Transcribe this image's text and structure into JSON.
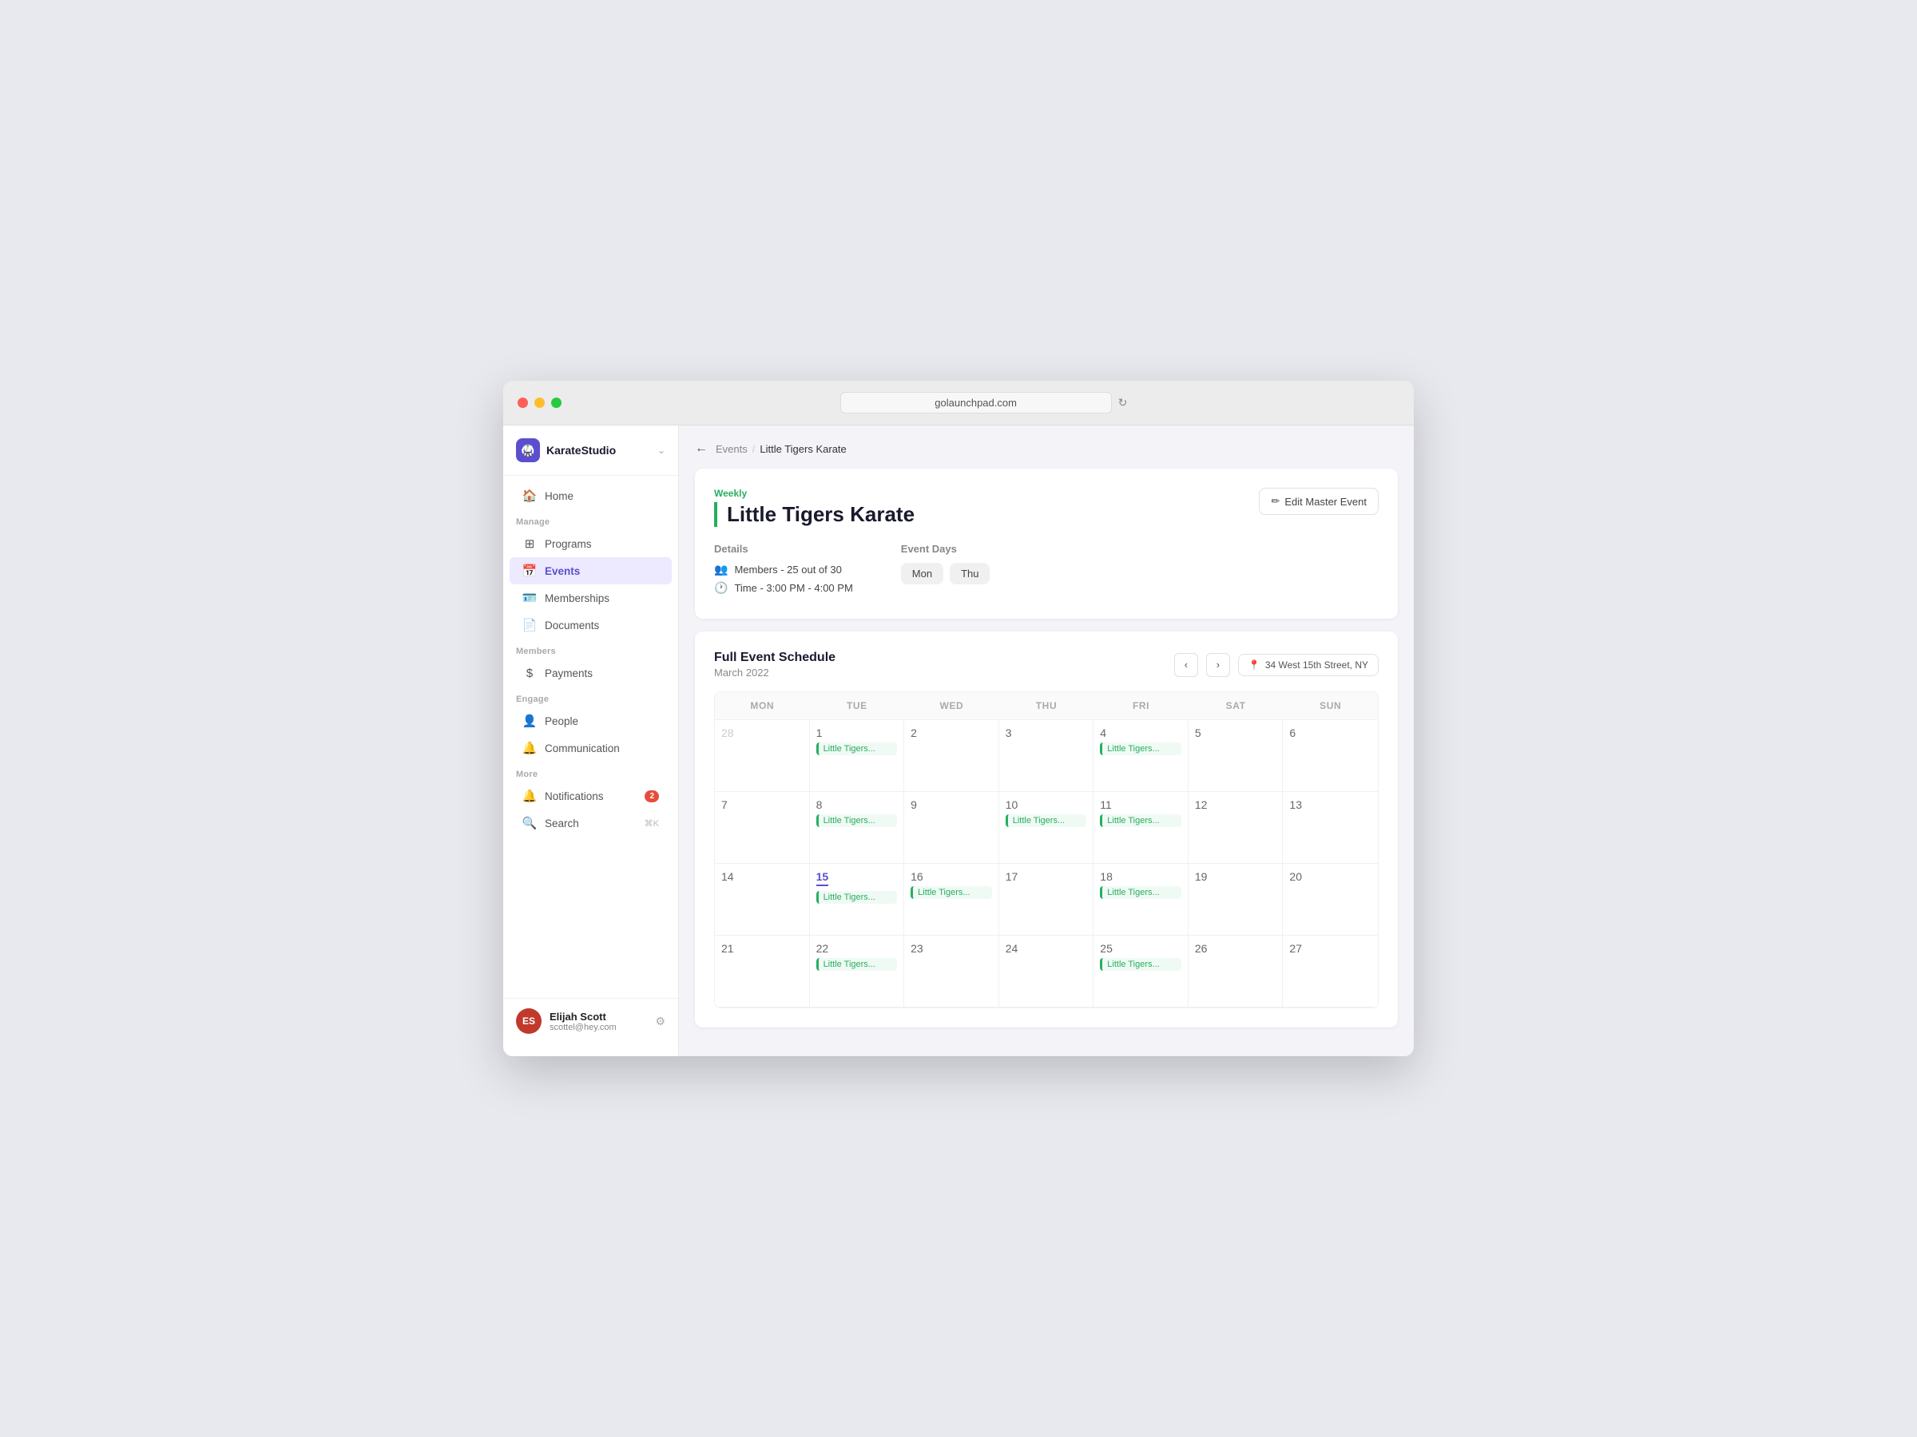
{
  "window": {
    "url": "golaunchpad.com"
  },
  "sidebar": {
    "brand": {
      "name": "KarateStudio",
      "icon": "🥋"
    },
    "nav_home": "Home",
    "section_manage": "Manage",
    "nav_programs": "Programs",
    "nav_events": "Events",
    "nav_memberships": "Memberships",
    "nav_documents": "Documents",
    "section_members": "Members",
    "nav_payments": "Payments",
    "section_engage": "Engage",
    "nav_people": "People",
    "nav_communication": "Communication",
    "section_more": "More",
    "nav_notifications": "Notifications",
    "notifications_badge": "2",
    "nav_search": "Search",
    "search_shortcut": "⌘K",
    "user": {
      "name": "Elijah Scott",
      "email": "scottel@hey.com",
      "initials": "ES"
    }
  },
  "breadcrumb": {
    "parent": "Events",
    "current": "Little Tigers Karate"
  },
  "event": {
    "frequency": "Weekly",
    "title": "Little Tigers Karate",
    "details_label": "Details",
    "members_label": "Members - 25 out of 30",
    "time_label": "Time - 3:00 PM - 4:00 PM",
    "event_days_label": "Event Days",
    "days": [
      "Mon",
      "Thu"
    ],
    "edit_button": "Edit Master Event"
  },
  "calendar": {
    "title": "Full Event Schedule",
    "month": "March 2022",
    "location": "34 West 15th Street, NY",
    "headers": [
      "MON",
      "TUE",
      "WED",
      "THU",
      "FRI",
      "SAT",
      "SUN"
    ],
    "event_chip_text": "Little Tigers...",
    "rows": [
      [
        {
          "day": "28",
          "other": true,
          "event": false
        },
        {
          "day": "1",
          "other": false,
          "event": true
        },
        {
          "day": "2",
          "other": false,
          "event": false
        },
        {
          "day": "3",
          "other": false,
          "event": false
        },
        {
          "day": "4",
          "other": false,
          "event": true
        },
        {
          "day": "5",
          "other": false,
          "event": false
        },
        {
          "day": "6",
          "other": false,
          "event": false
        }
      ],
      [
        {
          "day": "7",
          "other": false,
          "event": false
        },
        {
          "day": "8",
          "other": false,
          "event": true
        },
        {
          "day": "9",
          "other": false,
          "event": false
        },
        {
          "day": "10",
          "other": false,
          "event": true
        },
        {
          "day": "11",
          "other": false,
          "event": true
        },
        {
          "day": "12",
          "other": false,
          "event": false
        },
        {
          "day": "13",
          "other": false,
          "event": false
        }
      ],
      [
        {
          "day": "14",
          "other": false,
          "event": false
        },
        {
          "day": "15",
          "other": false,
          "event": true,
          "today": true
        },
        {
          "day": "16",
          "other": false,
          "event": true
        },
        {
          "day": "17",
          "other": false,
          "event": false
        },
        {
          "day": "18",
          "other": false,
          "event": true
        },
        {
          "day": "19",
          "other": false,
          "event": false
        },
        {
          "day": "20",
          "other": false,
          "event": false
        }
      ],
      [
        {
          "day": "21",
          "other": false,
          "event": false
        },
        {
          "day": "22",
          "other": false,
          "event": true
        },
        {
          "day": "23",
          "other": false,
          "event": false
        },
        {
          "day": "24",
          "other": false,
          "event": false
        },
        {
          "day": "25",
          "other": false,
          "event": true
        },
        {
          "day": "26",
          "other": false,
          "event": false
        },
        {
          "day": "27",
          "other": false,
          "event": false
        }
      ]
    ]
  }
}
